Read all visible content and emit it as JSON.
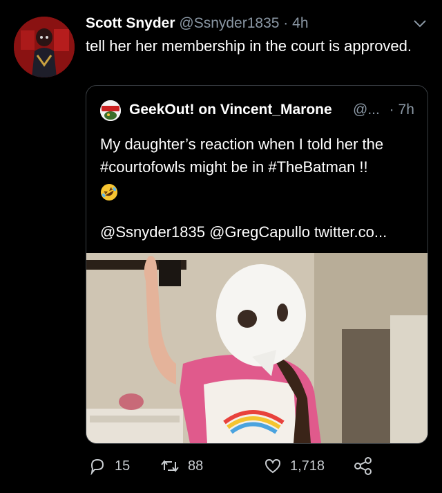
{
  "tweet": {
    "author_name": "Scott Snyder",
    "author_handle": "@Ssnyder1835",
    "separator": "·",
    "time": "4h",
    "text": "tell her her membership in the court is approved."
  },
  "quoted_tweet": {
    "author_name": "GeekOut! on Vincent_Marone",
    "author_handle": "@...",
    "separator": "·",
    "time": "7h",
    "text": "My daughter’s reaction when I told her the #courtofowls might be in #TheBatman !!",
    "mentions": "@Ssnyder1835 @GregCapullo twitter.co..."
  },
  "actions": {
    "reply_count": "15",
    "retweet_count": "88",
    "like_count": "1,718"
  },
  "icons": {
    "reply": "reply-icon",
    "retweet": "retweet-icon",
    "like": "heart-icon",
    "share": "share-icon",
    "caret": "chevron-down-icon",
    "emoji": "rolling-on-floor-laughing-emoji"
  },
  "colors": {
    "background": "#000000",
    "text": "#ffffff",
    "secondary": "#8b98a5",
    "border": "#3a3f44"
  }
}
